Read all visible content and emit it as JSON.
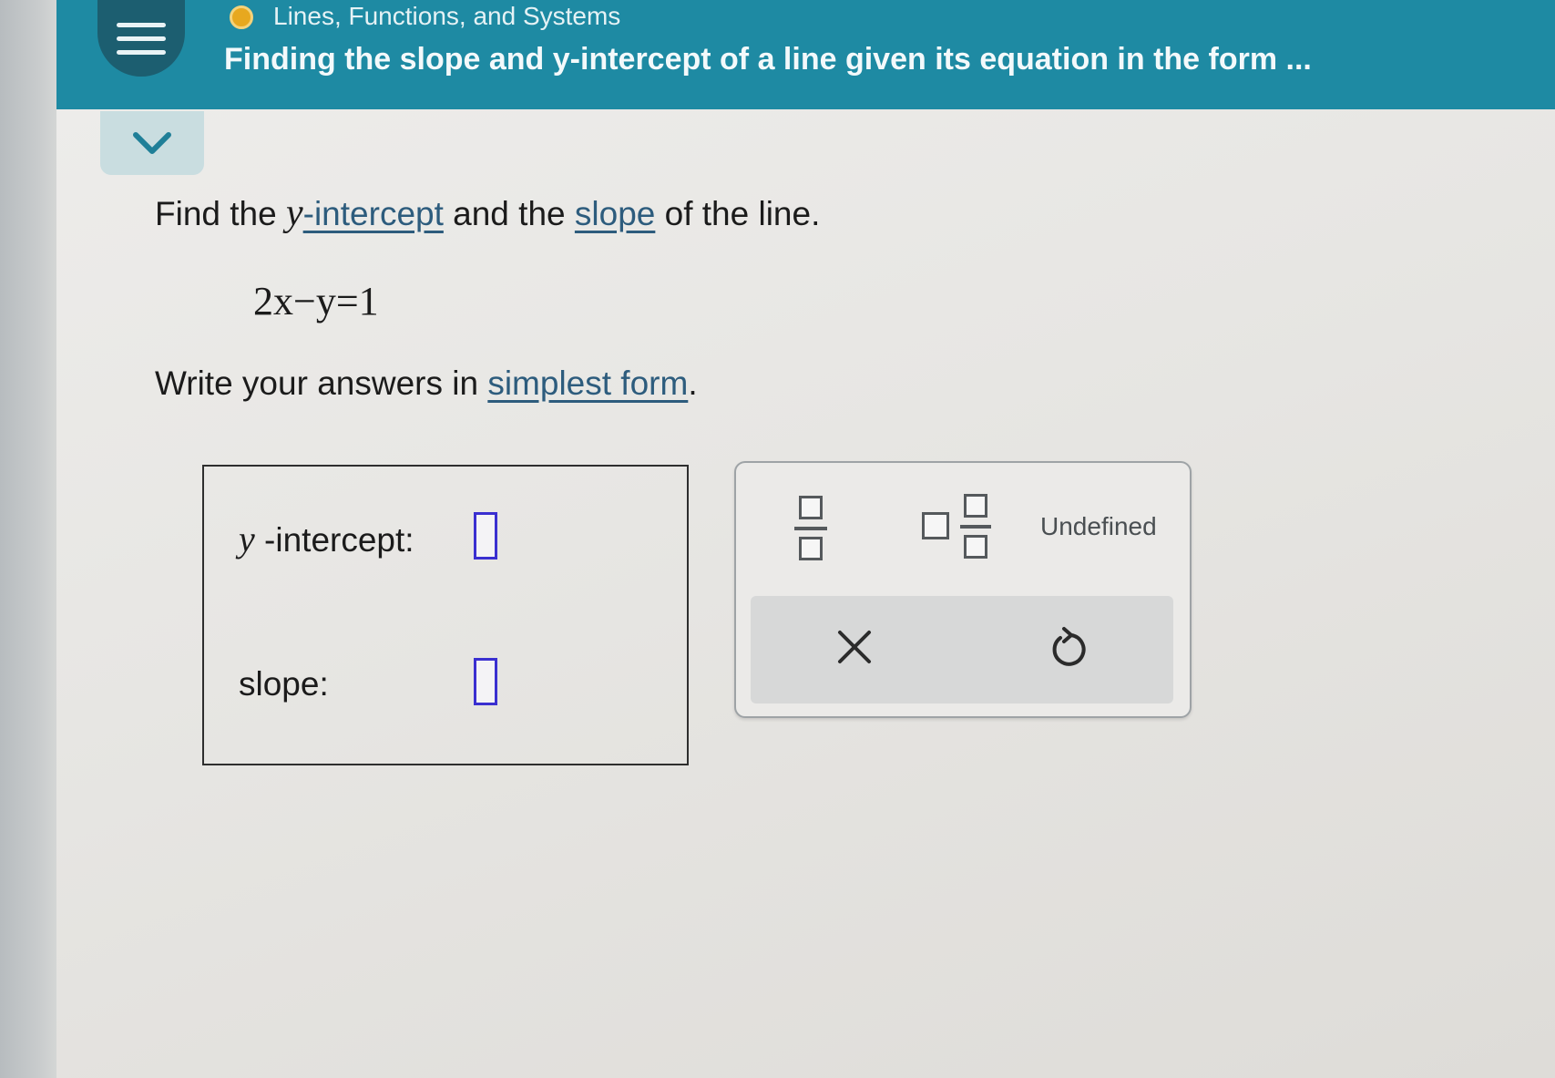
{
  "header": {
    "topic": "Lines, Functions, and Systems",
    "title": "Finding the slope and y-intercept of a line given its equation in the form ..."
  },
  "question": {
    "line1_prefix": "Find the ",
    "line1_var": "y",
    "line1_term1": "-intercept",
    "line1_mid": " and the ",
    "line1_term2": "slope",
    "line1_suffix": " of the line.",
    "equation": "2x−y=1",
    "line2_prefix": "Write your answers in ",
    "line2_term": "simplest form",
    "line2_suffix": "."
  },
  "answers": {
    "intercept_var": "y",
    "intercept_label": "-intercept:",
    "slope_label": "slope:"
  },
  "keypad": {
    "undefined_label": "Undefined",
    "clear_symbol": "×",
    "reset_symbol": "↺"
  },
  "colors": {
    "header": "#1e8aa3",
    "menu_button": "#1c5e70",
    "input_border": "#3a2fd0",
    "link_text": "#2d5c7d"
  },
  "icons": [
    "menu-icon",
    "progress-dot-icon",
    "chevron-down-icon",
    "fraction-icon",
    "mixed-number-icon",
    "clear-icon",
    "undo-icon"
  ]
}
